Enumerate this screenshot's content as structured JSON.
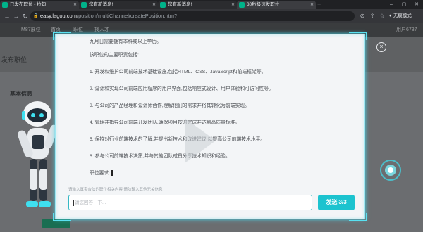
{
  "browser": {
    "tabs": [
      {
        "label": "已发布职位 - 拉勾",
        "active": false
      },
      {
        "label": "您有新消息!",
        "active": false
      },
      {
        "label": "您有新消息!",
        "active": false
      },
      {
        "label": "30秒极速发职位",
        "active": true
      }
    ],
    "url_host": "easy.lagou.com",
    "url_path": "/position/multiChannel/createPosition.htm?",
    "incognito_label": "无痕模式"
  },
  "site": {
    "nav": [
      "M87展位",
      "首页",
      "职位",
      "找人才",
      "用户6737"
    ],
    "side_title": "发布职位",
    "side_section": "基本信息"
  },
  "modal": {
    "intro": "九月日需要拥有本科或以上学历。",
    "duties_heading": "该职位的主要职责包括:",
    "duties": [
      "1. 开发和维护公司前端技术基础设施,包括HTML、CSS、JavaScript和前端框架等。",
      "2. 设计和实现公司前端应用程序的用户界面,包括响应式设计、用户体验和可访问性等。",
      "3. 与公司的产品经理和设计师合作,理解他们的需求并将其转化为前端实现。",
      "4. 管理并指导公司前端开发团队,确保项目按时完成并达到高质量标准。",
      "5. 保持对行业前端技术的了解,并提出新技术和改进建议,以提高公司前端技术水平。",
      "6. 参与公司前端技术决策,并与其他团队成员分享技术知识和经验。"
    ],
    "requirements_label": "职位要求:",
    "input_hint": "请输入真实合法的职位相关内容,请勿输入其他无关信息",
    "input_placeholder": "请您回答一下...",
    "send_label": "发送 3/3"
  },
  "colors": {
    "accent": "#1cc3cf",
    "frame_glow": "#48d3e6"
  }
}
